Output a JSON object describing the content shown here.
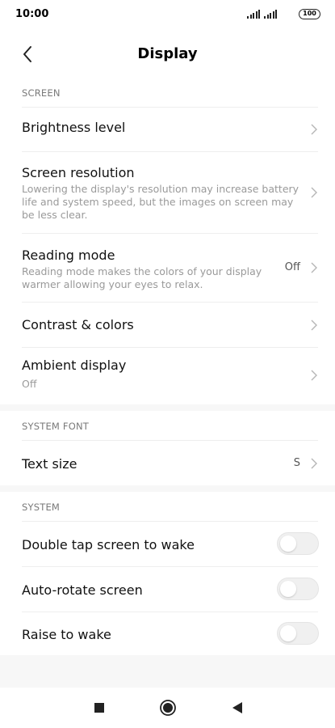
{
  "status_bar": {
    "time": "10:00",
    "battery": "100"
  },
  "header": {
    "title": "Display",
    "back_icon": "chevron-left-icon"
  },
  "sections": {
    "screen": {
      "label": "SCREEN",
      "items": [
        {
          "title": "Brightness level"
        },
        {
          "title": "Screen resolution",
          "subtitle": "Lowering the display's resolution may increase battery life and system speed, but the images on screen may be less clear."
        },
        {
          "title": "Reading mode",
          "subtitle": "Reading mode makes the colors of your display warmer allowing your eyes to relax.",
          "value": "Off"
        },
        {
          "title": "Contrast & colors"
        },
        {
          "title": "Ambient display",
          "subtitle": "Off"
        }
      ]
    },
    "system_font": {
      "label": "SYSTEM FONT",
      "items": [
        {
          "title": "Text size",
          "value": "S"
        }
      ]
    },
    "system": {
      "label": "SYSTEM",
      "items": [
        {
          "title": "Double tap screen to wake",
          "enabled": false
        },
        {
          "title": "Auto-rotate screen",
          "enabled": false
        },
        {
          "title": "Raise to wake",
          "enabled": false
        }
      ]
    }
  },
  "nav_bar": {
    "recents_icon": "square-icon",
    "home_icon": "circle-icon",
    "back_icon": "triangle-back-icon"
  },
  "colors": {
    "background": "#f7f7f7",
    "card": "#ffffff",
    "section_label": "#7a7a7a",
    "subtitle": "#9a9a9a",
    "toggle_off": "#f0f0f0"
  }
}
